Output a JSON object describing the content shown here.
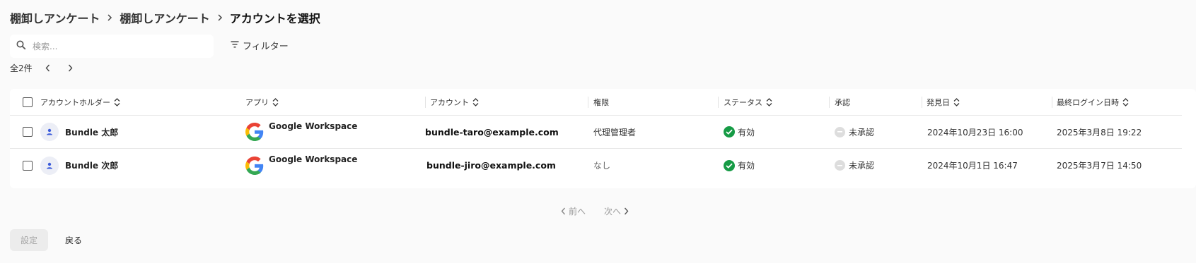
{
  "breadcrumb": {
    "items": [
      "棚卸しアンケート",
      "棚卸しアンケート",
      "アカウントを選択"
    ]
  },
  "search": {
    "placeholder": "検索..."
  },
  "filter": {
    "label": "フィルター"
  },
  "list": {
    "total_label": "全2件"
  },
  "table": {
    "columns": [
      "アカウントホルダー",
      "アプリ",
      "アカウント",
      "権限",
      "ステータス",
      "承認",
      "発見日",
      "最終ログイン日時"
    ],
    "rows": [
      {
        "holder": "Bundle 太郎",
        "app": "Google Workspace",
        "account": "bundle-taro@example.com",
        "permission": "代理管理者",
        "status": "有効",
        "approval": "未承認",
        "discovered": "2024年10月23日 16:00",
        "last_login": "2025年3月8日 19:22"
      },
      {
        "holder": "Bundle 次郎",
        "app": "Google Workspace",
        "account": "bundle-jiro@example.com",
        "permission": "なし",
        "status": "有効",
        "approval": "未承認",
        "discovered": "2024年10月1日 16:47",
        "last_login": "2025年3月7日 14:50"
      }
    ]
  },
  "pagination": {
    "prev": "前へ",
    "next": "次へ"
  },
  "actions": {
    "setting": "設定",
    "back": "戻る"
  },
  "colors": {
    "status_active": "#169b45",
    "avatar_blue": "#3b5bdb",
    "pending": "#dddddd"
  }
}
